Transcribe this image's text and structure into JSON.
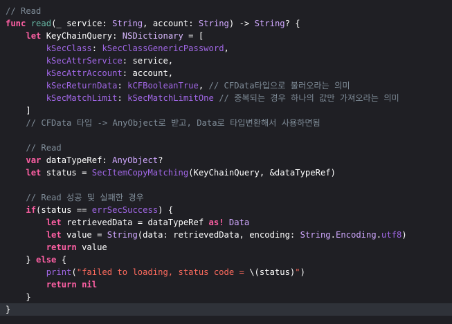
{
  "editor": {
    "background": "#1f1f24",
    "current_line_background": "#2f3239",
    "colors": {
      "comment": "#7f8c98",
      "keyword": "#fc5fa3",
      "function_name": "#67b7a4",
      "type": "#d0a8ff",
      "system_constant": "#a167e6",
      "class_name": "#dabaff",
      "string": "#fc6a5d",
      "plain": "#ffffff"
    },
    "lines": [
      {
        "tokens": [
          {
            "t": "// Read",
            "k": "com"
          }
        ]
      },
      {
        "tokens": [
          {
            "t": "func",
            "k": "kw"
          },
          {
            "t": " ",
            "k": "pln"
          },
          {
            "t": "read",
            "k": "fn"
          },
          {
            "t": "(_ service: ",
            "k": "pln"
          },
          {
            "t": "String",
            "k": "type"
          },
          {
            "t": ", account: ",
            "k": "pln"
          },
          {
            "t": "String",
            "k": "type"
          },
          {
            "t": ") -> ",
            "k": "pln"
          },
          {
            "t": "String",
            "k": "type"
          },
          {
            "t": "? {",
            "k": "pln"
          }
        ]
      },
      {
        "tokens": [
          {
            "t": "    ",
            "k": "pln"
          },
          {
            "t": "let",
            "k": "kw"
          },
          {
            "t": " KeyChainQuery: ",
            "k": "pln"
          },
          {
            "t": "NSDictionary",
            "k": "cls"
          },
          {
            "t": " = [",
            "k": "pln"
          }
        ]
      },
      {
        "tokens": [
          {
            "t": "        ",
            "k": "pln"
          },
          {
            "t": "kSecClass",
            "k": "sys"
          },
          {
            "t": ": ",
            "k": "pln"
          },
          {
            "t": "kSecClassGenericPassword",
            "k": "sys"
          },
          {
            "t": ",",
            "k": "pln"
          }
        ]
      },
      {
        "tokens": [
          {
            "t": "        ",
            "k": "pln"
          },
          {
            "t": "kSecAttrService",
            "k": "sys"
          },
          {
            "t": ": service,",
            "k": "pln"
          }
        ]
      },
      {
        "tokens": [
          {
            "t": "        ",
            "k": "pln"
          },
          {
            "t": "kSecAttrAccount",
            "k": "sys"
          },
          {
            "t": ": account,",
            "k": "pln"
          }
        ]
      },
      {
        "tokens": [
          {
            "t": "        ",
            "k": "pln"
          },
          {
            "t": "kSecReturnData",
            "k": "sys"
          },
          {
            "t": ": ",
            "k": "pln"
          },
          {
            "t": "kCFBooleanTrue",
            "k": "sys"
          },
          {
            "t": ", ",
            "k": "pln"
          },
          {
            "t": "// CFData타입으로 불러오라는 의미",
            "k": "com"
          }
        ]
      },
      {
        "tokens": [
          {
            "t": "        ",
            "k": "pln"
          },
          {
            "t": "kSecMatchLimit",
            "k": "sys"
          },
          {
            "t": ": ",
            "k": "pln"
          },
          {
            "t": "kSecMatchLimitOne",
            "k": "sys"
          },
          {
            "t": " ",
            "k": "pln"
          },
          {
            "t": "// 중복되는 경우 하나의 값만 가져오라는 의미",
            "k": "com"
          }
        ]
      },
      {
        "tokens": [
          {
            "t": "    ]",
            "k": "pln"
          }
        ]
      },
      {
        "tokens": [
          {
            "t": "    ",
            "k": "pln"
          },
          {
            "t": "// CFData 타입 -> AnyObject로 받고, Data로 타입변환해서 사용하면됨",
            "k": "com"
          }
        ]
      },
      {
        "tokens": []
      },
      {
        "tokens": [
          {
            "t": "    ",
            "k": "pln"
          },
          {
            "t": "// Read",
            "k": "com"
          }
        ]
      },
      {
        "tokens": [
          {
            "t": "    ",
            "k": "pln"
          },
          {
            "t": "var",
            "k": "kw"
          },
          {
            "t": " dataTypeRef: ",
            "k": "pln"
          },
          {
            "t": "AnyObject",
            "k": "type"
          },
          {
            "t": "?",
            "k": "pln"
          }
        ]
      },
      {
        "tokens": [
          {
            "t": "    ",
            "k": "pln"
          },
          {
            "t": "let",
            "k": "kw"
          },
          {
            "t": " status = ",
            "k": "pln"
          },
          {
            "t": "SecItemCopyMatching",
            "k": "sys"
          },
          {
            "t": "(KeyChainQuery, &dataTypeRef)",
            "k": "pln"
          }
        ]
      },
      {
        "tokens": []
      },
      {
        "tokens": [
          {
            "t": "    ",
            "k": "pln"
          },
          {
            "t": "// Read 성공 및 실패한 경우",
            "k": "com"
          }
        ]
      },
      {
        "tokens": [
          {
            "t": "    ",
            "k": "pln"
          },
          {
            "t": "if",
            "k": "kw"
          },
          {
            "t": "(status == ",
            "k": "pln"
          },
          {
            "t": "errSecSuccess",
            "k": "sys"
          },
          {
            "t": ") {",
            "k": "pln"
          }
        ]
      },
      {
        "tokens": [
          {
            "t": "        ",
            "k": "pln"
          },
          {
            "t": "let",
            "k": "kw"
          },
          {
            "t": " retrievedData = dataTypeRef ",
            "k": "pln"
          },
          {
            "t": "as!",
            "k": "kw"
          },
          {
            "t": " ",
            "k": "pln"
          },
          {
            "t": "Data",
            "k": "type"
          }
        ]
      },
      {
        "tokens": [
          {
            "t": "        ",
            "k": "pln"
          },
          {
            "t": "let",
            "k": "kw"
          },
          {
            "t": " value = ",
            "k": "pln"
          },
          {
            "t": "String",
            "k": "type"
          },
          {
            "t": "(data: retrievedData, encoding: ",
            "k": "pln"
          },
          {
            "t": "String",
            "k": "type"
          },
          {
            "t": ".",
            "k": "pln"
          },
          {
            "t": "Encoding",
            "k": "type"
          },
          {
            "t": ".",
            "k": "pln"
          },
          {
            "t": "utf8",
            "k": "sys"
          },
          {
            "t": ")",
            "k": "pln"
          }
        ]
      },
      {
        "tokens": [
          {
            "t": "        ",
            "k": "pln"
          },
          {
            "t": "return",
            "k": "kw"
          },
          {
            "t": " value",
            "k": "pln"
          }
        ]
      },
      {
        "tokens": [
          {
            "t": "    } ",
            "k": "pln"
          },
          {
            "t": "else",
            "k": "kw"
          },
          {
            "t": " {",
            "k": "pln"
          }
        ]
      },
      {
        "tokens": [
          {
            "t": "        ",
            "k": "pln"
          },
          {
            "t": "print",
            "k": "sys"
          },
          {
            "t": "(",
            "k": "pln"
          },
          {
            "t": "\"failed to loading, status code = ",
            "k": "str"
          },
          {
            "t": "\\(status)",
            "k": "pln"
          },
          {
            "t": "\"",
            "k": "str"
          },
          {
            "t": ")",
            "k": "pln"
          }
        ]
      },
      {
        "tokens": [
          {
            "t": "        ",
            "k": "pln"
          },
          {
            "t": "return",
            "k": "kw"
          },
          {
            "t": " ",
            "k": "pln"
          },
          {
            "t": "nil",
            "k": "kw"
          }
        ]
      },
      {
        "tokens": [
          {
            "t": "    }",
            "k": "pln"
          }
        ]
      },
      {
        "tokens": [
          {
            "t": "}",
            "k": "pln"
          }
        ],
        "current": true
      }
    ]
  }
}
